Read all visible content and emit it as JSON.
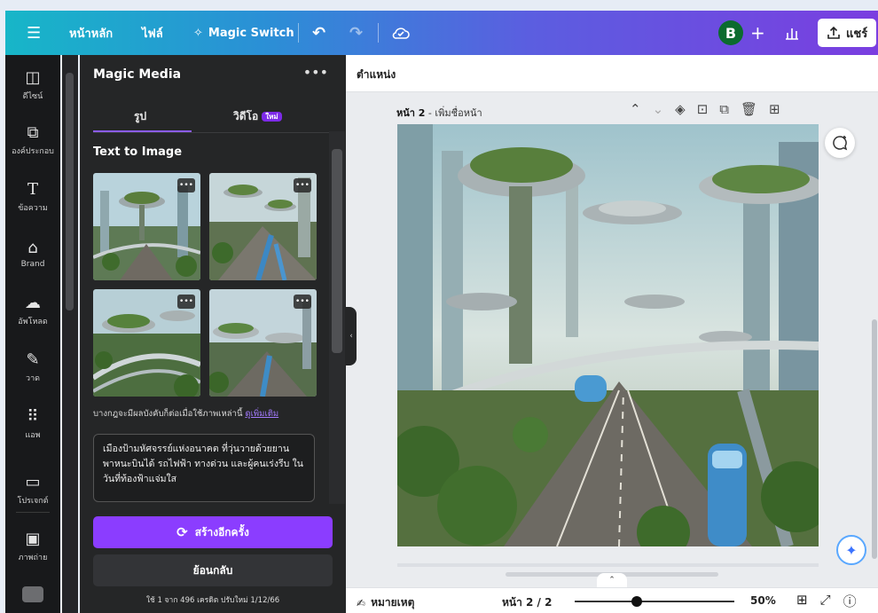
{
  "topbar": {
    "menu_icon": "hamburger-icon",
    "home": "หน้าหลัก",
    "file": "ไฟล์",
    "magic_switch": "Magic Switch",
    "avatar_letter": "B",
    "share": "แชร์"
  },
  "rail": {
    "items": [
      {
        "label": "ดีไซน์",
        "icon": "design-icon"
      },
      {
        "label": "องค์ประกอบ",
        "icon": "elements-icon"
      },
      {
        "label": "ข้อความ",
        "icon": "text-icon"
      },
      {
        "label": "Brand",
        "icon": "brand-icon"
      },
      {
        "label": "อัพโหลด",
        "icon": "upload-icon"
      },
      {
        "label": "วาด",
        "icon": "draw-icon"
      },
      {
        "label": "แอพ",
        "icon": "apps-icon"
      },
      {
        "label": "โปรเจกต์",
        "icon": "folder-icon"
      },
      {
        "label": "ภาพถ่าย",
        "icon": "photos-icon"
      }
    ]
  },
  "panel": {
    "title": "Magic Media",
    "tab_image": "รูป",
    "tab_video": "วิดีโอ",
    "new_badge": "ใหม่",
    "section_title": "Text to Image",
    "note": "บางกฎจะมีผลบังคับก็ต่อเมื่อใช้ภาพเหล่านี้",
    "note_link": "ดูเพิ่มเติม",
    "prompt": "เมืองป้ามหัศจรรย์แห่งอนาคต ที่วุ่นวายด้วยยานพาหนะบินได้ รถไฟฟ้า ทางด่วน และผู้คนเร่งรีบ ในวันที่ท้องฟ้าแจ่มใส",
    "regenerate": "สร้างอีกครั้ง",
    "back": "ย้อนกลับ",
    "credits": "ใช้ 1 จาก 496 เครดิต ปรับใหม่ 1/12/66"
  },
  "editor": {
    "position": "ตำแหน่ง",
    "page_prefix": "หน้า 2",
    "page_suffix": " - เพิ่มชื่อหน้า",
    "notes": "หมายเหตุ",
    "page_count": "หน้า 2 / 2",
    "zoom": "50%"
  }
}
